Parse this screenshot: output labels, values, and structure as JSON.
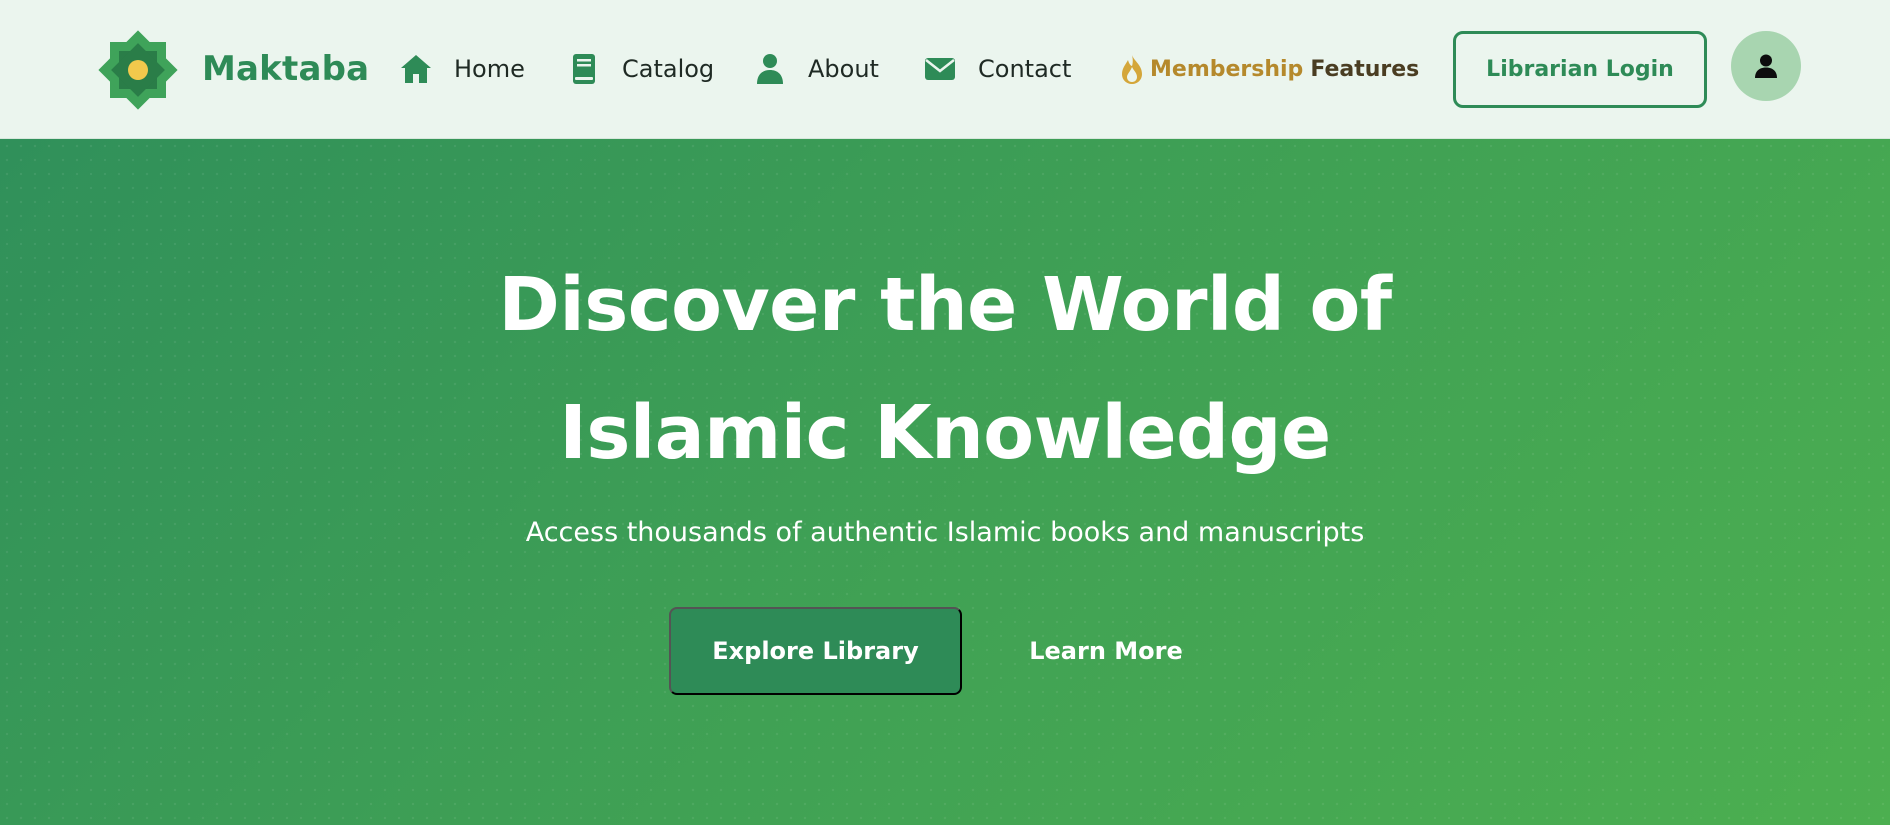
{
  "brand": {
    "name": "Maktaba",
    "logo_icon": "eight-point-star-logo-icon"
  },
  "nav": {
    "items": [
      {
        "label": "Home",
        "icon": "home-icon"
      },
      {
        "label": "Catalog",
        "icon": "book-icon"
      },
      {
        "label": "About",
        "icon": "user-icon"
      },
      {
        "label": "Contact",
        "icon": "envelope-icon"
      }
    ],
    "membership": {
      "word1": "Membership",
      "word2": "Features",
      "icon": "flame-icon"
    },
    "login_label": "Librarian Login",
    "avatar_icon": "user-avatar-icon"
  },
  "hero": {
    "title_line1": "Discover the World of",
    "title_line2": "Islamic Knowledge",
    "subtitle": "Access thousands of authentic Islamic books and manuscripts",
    "primary_button": "Explore Library",
    "secondary_button": "Learn More"
  },
  "colors": {
    "primary": "#2e8b57",
    "hero_gradient_start": "#30905a",
    "hero_gradient_end": "#4caf50",
    "gold": "#b5892c",
    "nav_background": "#ebf5ee"
  }
}
